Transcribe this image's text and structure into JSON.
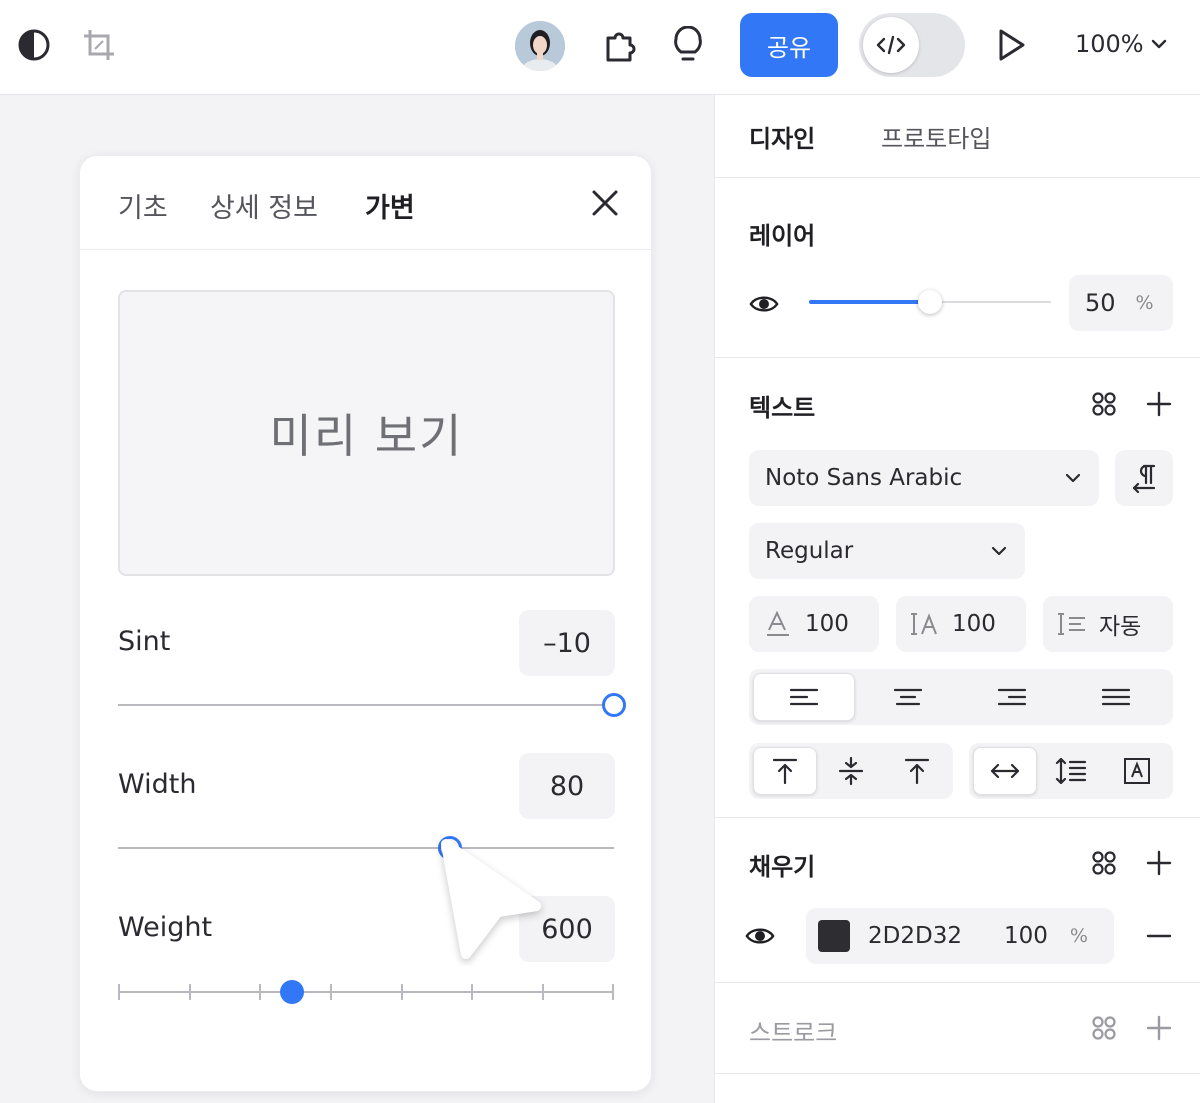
{
  "toolbar": {
    "share_label": "공유",
    "zoom": "100%",
    "icons": [
      "contrast-icon",
      "crop-icon",
      "plugin-icon",
      "lightbulb-icon",
      "code-icon",
      "play-icon",
      "chevron-down-icon"
    ]
  },
  "card": {
    "tabs": [
      {
        "label": "기초",
        "active": false
      },
      {
        "label": "상세 정보",
        "active": false
      },
      {
        "label": "가변",
        "active": true
      }
    ],
    "preview_text": "미리 보기",
    "axes": [
      {
        "label": "Sint",
        "value": "–10",
        "level": 1.0
      },
      {
        "label": "Width",
        "value": "80",
        "level": 0.67
      },
      {
        "label": "Weight",
        "value": "600",
        "level": 0.36
      }
    ]
  },
  "panel": {
    "tabs": [
      {
        "label": "디자인",
        "active": true
      },
      {
        "label": "프로토타입",
        "active": false
      }
    ],
    "layer": {
      "title": "레이어",
      "opacity_value": "50",
      "opacity_unit": "%",
      "opacity_level": 0.5
    },
    "text": {
      "title": "텍스트",
      "font_family": "Noto Sans Arabic",
      "font_weight": "Regular",
      "font_size": "100",
      "letter_spacing": "100",
      "line_height": "자동"
    },
    "fill": {
      "title": "채우기",
      "hex": "2D2D32",
      "opacity": "100",
      "unit": "%",
      "color": "#2d2d32"
    },
    "stroke": {
      "title": "스트로크"
    }
  },
  "colors": {
    "accent": "#3277f5"
  }
}
